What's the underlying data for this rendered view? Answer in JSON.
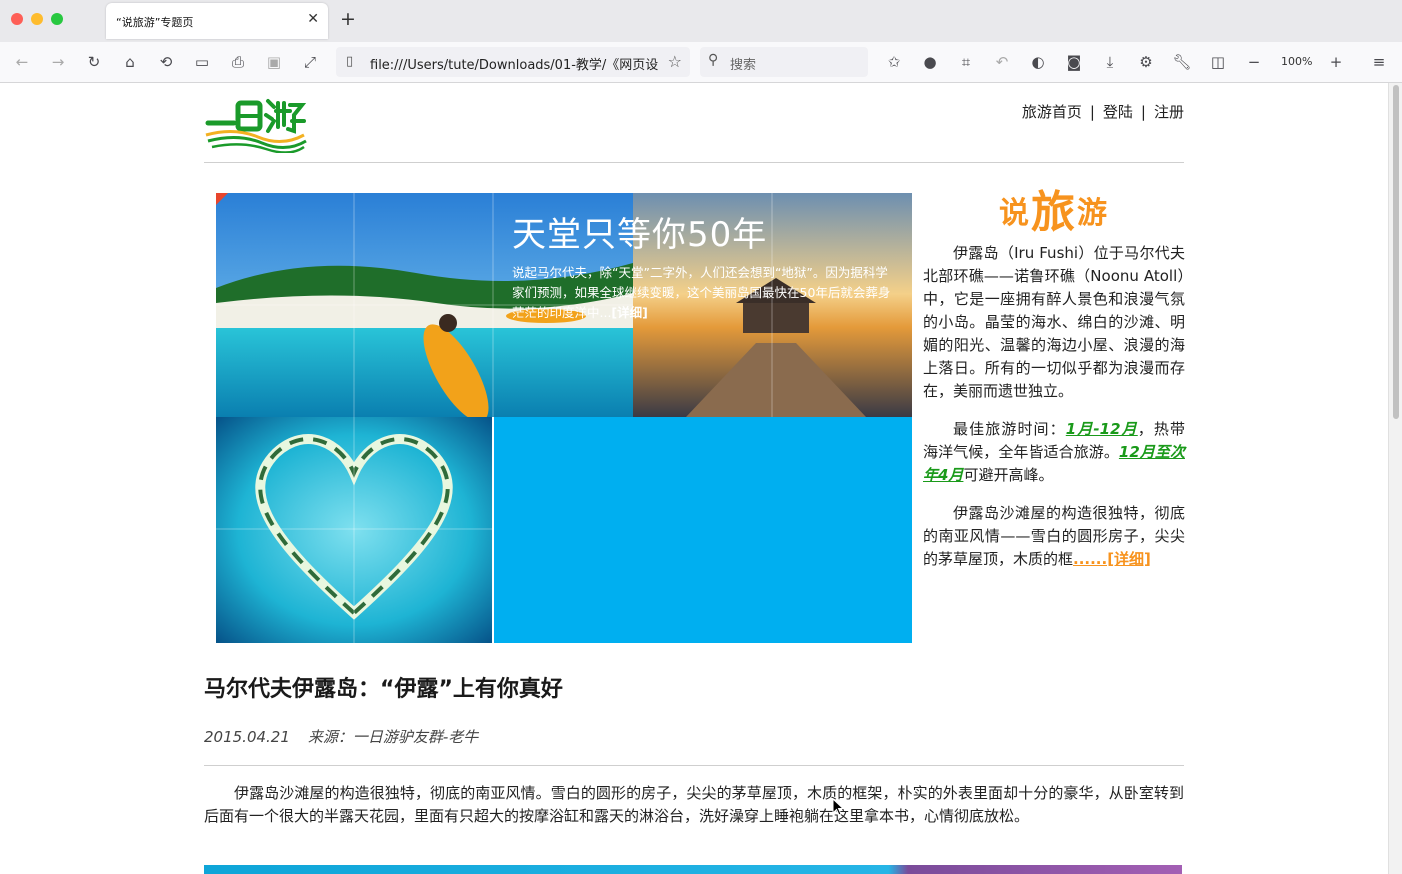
{
  "browser": {
    "tab_title": "“说旅游”专题页",
    "url": "file:///Users/tute/Downloads/01-教学/《网页设",
    "search_placeholder": "搜索",
    "zoom": "100%"
  },
  "header": {
    "nav": [
      "旅游首页",
      "登陆",
      "注册"
    ],
    "nav_sep": "|"
  },
  "banner": {
    "title": "天堂只等你50年",
    "text": "说起马尔代夫，除“天堂”二字外，人们还会想到“地狱”。因为据科学家们预测，如果全球继续变暖，这个美丽岛国最快在50年后就会葬身茫茫的印度洋中...",
    "more": "[详细]"
  },
  "sidebar": {
    "title_1": "说",
    "title_2": "旅",
    "title_3": "游",
    "para1": "伊露岛（Iru Fushi）位于马尔代夫北部环礁——诺鲁环礁（Noonu Atoll）中，它是一座拥有醉人景色和浪漫气氛的小岛。晶莹的海水、绵白的沙滩、明媚的阳光、温馨的海边小屋、浪漫的海上落日。所有的一切似乎都为浪漫而存在，美丽而遗世独立。",
    "para2_a": "最佳旅游时间：",
    "para2_b": "1月-12月",
    "para2_c": "，热带海洋气候，全年皆适合旅游。",
    "para2_d": "12月至次年4月",
    "para2_e": "可避开高峰。",
    "para3": "伊露岛沙滩屋的构造很独特，彻底的南亚风情——雪白的圆形房子，尖尖的茅草屋顶，木质的框",
    "para3_more": "......[详细]"
  },
  "article": {
    "title": "马尔代夫伊露岛：“伊露”上有你真好",
    "date": "2015.04.21",
    "source": "来源：一日游驴友群-老牛",
    "body": "伊露岛沙滩屋的构造很独特，彻底的南亚风情。雪白的圆形的房子，尖尖的茅草屋顶，木质的框架，朴实的外表里面却十分的豪华，从卧室转到后面有一个很大的半露天花园，里面有只超大的按摩浴缸和露天的淋浴台，洗好澡穿上睡袍躺在这里拿本书，心情彻底放松。"
  },
  "colors": {
    "accent_orange": "#f7931e",
    "accent_green": "#1a9a1a",
    "banner_blue": "#00aff0"
  }
}
